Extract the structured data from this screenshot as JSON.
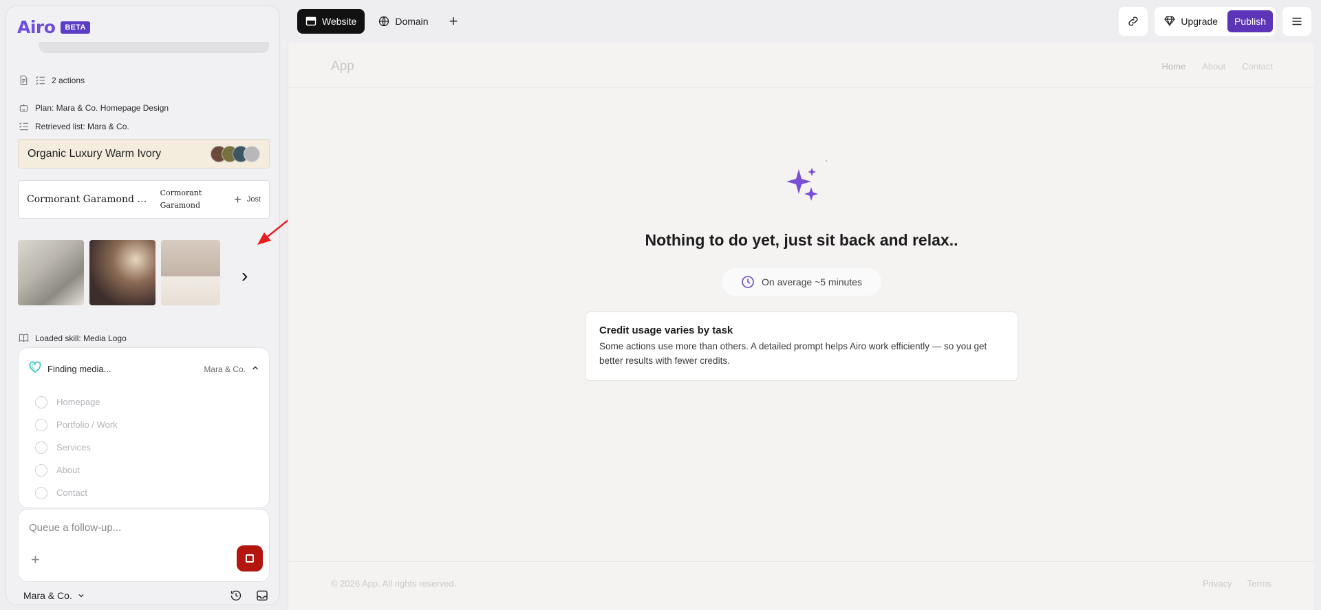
{
  "app": {
    "logo": "Airo",
    "badge": "BETA"
  },
  "sidebar": {
    "actions_label": "2 actions",
    "plan_label": "Plan: Mara & Co. Homepage Design",
    "retrieved_label": "Retrieved list: Mara & Co.",
    "palette": {
      "name": "Organic Luxury Warm Ivory",
      "colors": [
        "#6b4a3c",
        "#77703f",
        "#3e5563",
        "#b8b8b8"
      ]
    },
    "fonts": {
      "primary": "Cormorant Garamond & Jost",
      "secondary": "Cormorant Garamond",
      "alt": "Jost"
    },
    "skill_label": "Loaded skill: Media Logo",
    "task": {
      "title": "Finding media...",
      "project": "Mara & Co.",
      "items": [
        "Homepage",
        "Portfolio / Work",
        "Services",
        "About",
        "Contact"
      ]
    },
    "composer": {
      "placeholder": "Queue a follow-up..."
    },
    "project_selector": "Mara & Co."
  },
  "topbar": {
    "tabs": [
      {
        "label": "Website",
        "active": true,
        "icon": "browser-window-icon"
      },
      {
        "label": "Domain",
        "active": false,
        "icon": "globe-icon"
      }
    ],
    "upgrade_label": "Upgrade",
    "publish_label": "Publish",
    "accent": "#5b34b8"
  },
  "preview": {
    "app_title": "App",
    "nav": [
      "Home",
      "About",
      "Contact"
    ],
    "empty_title": "Nothing to do yet, just sit back and relax..",
    "eta": "On average ~5 minutes",
    "credit": {
      "title": "Credit usage varies by task",
      "body": "Some actions use more than others. A detailed prompt helps Airo work efficiently — so you get better results with fewer credits."
    },
    "copyright": "© 2026 App. All rights reserved.",
    "footer_links": [
      "Privacy",
      "Terms"
    ]
  }
}
